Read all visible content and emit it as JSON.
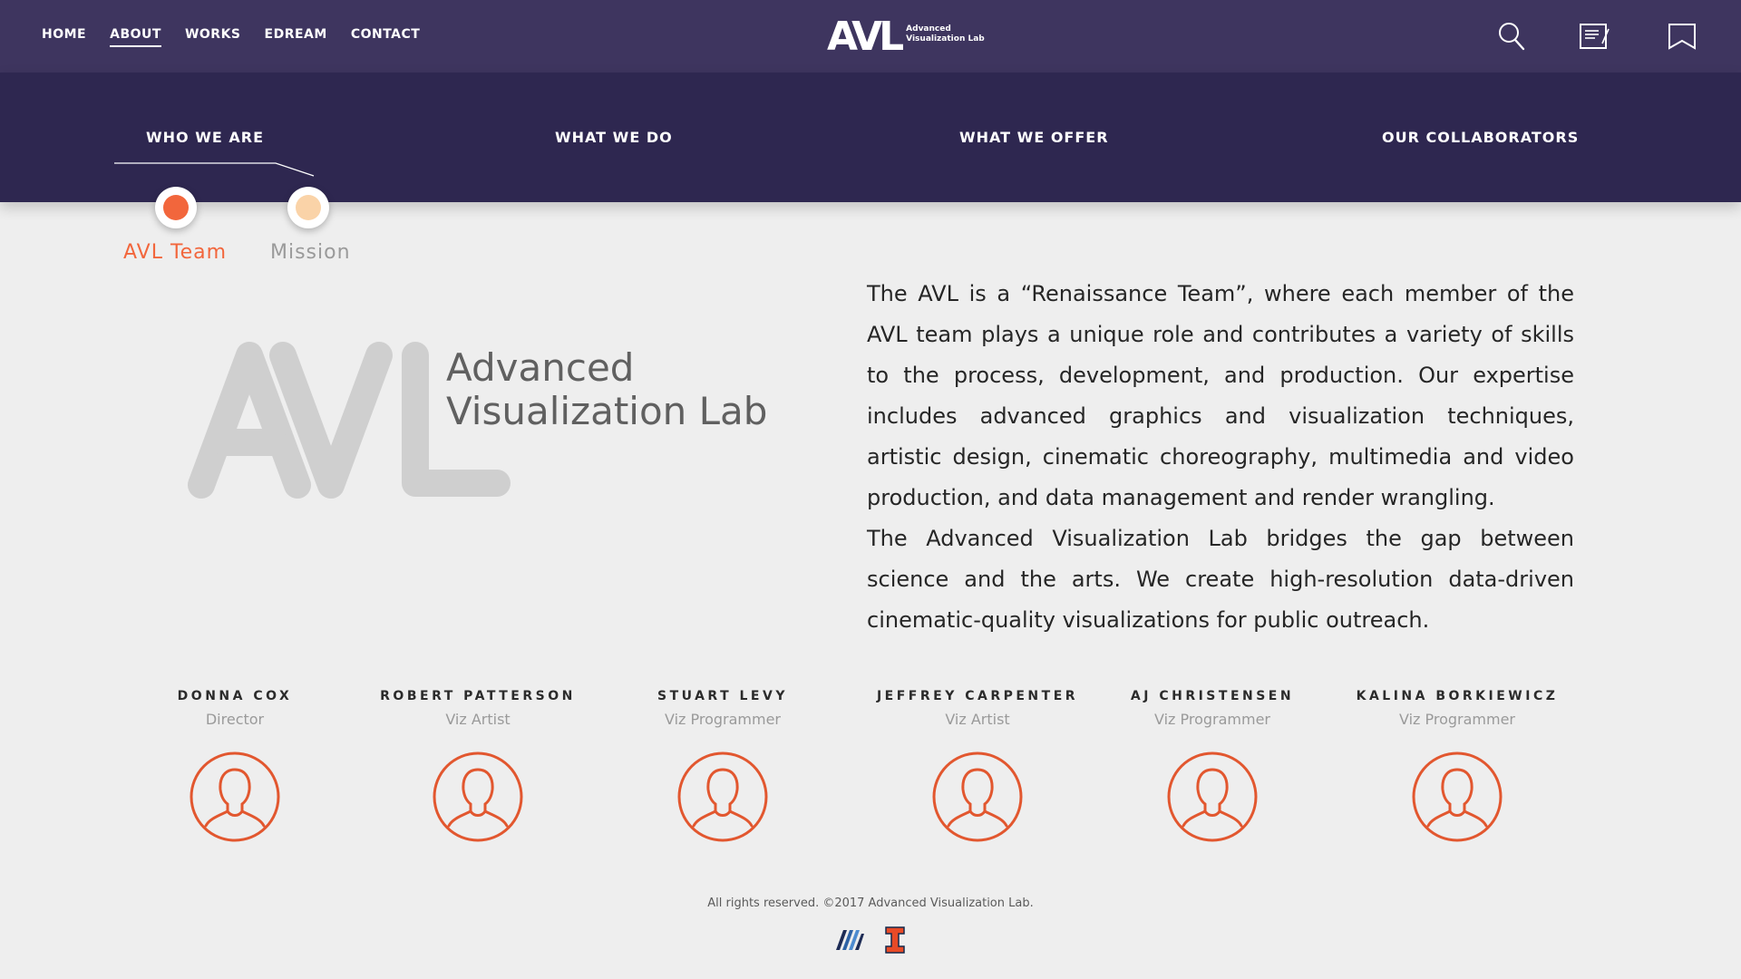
{
  "nav": {
    "items": [
      {
        "label": "HOME",
        "active": false
      },
      {
        "label": "ABOUT",
        "active": true
      },
      {
        "label": "WORKS",
        "active": false
      },
      {
        "label": "EDREAM",
        "active": false
      },
      {
        "label": "CONTACT",
        "active": false
      }
    ]
  },
  "brand": {
    "mark": "AVL",
    "line1": "Advanced",
    "line2": "Visualization Lab"
  },
  "top_icons": [
    "search-icon",
    "notes-icon",
    "bookmark-icon"
  ],
  "sections": [
    {
      "label": "WHO WE ARE",
      "active": true
    },
    {
      "label": "WHAT WE DO",
      "active": false
    },
    {
      "label": "WHAT WE OFFER",
      "active": false
    },
    {
      "label": "OUR COLLABORATORS",
      "active": false
    }
  ],
  "subpages": [
    {
      "label": "AVL Team",
      "active": true,
      "color": "#f2663c"
    },
    {
      "label": "Mission",
      "active": false,
      "color": "#fad3a8"
    }
  ],
  "big_logo": {
    "line1": "Advanced",
    "line2": "Visualization Lab"
  },
  "description": {
    "p1": "The AVL is a “Renaissance Team”, where each member of the AVL team plays a unique role and contributes a variety of skills to the process, development, and production.  Our expertise includes advanced graphics and visualization techniques, artistic design, cinematic choreography, multimedia and video production, and data management and render wrangling.",
    "p2": "The Advanced Visualization Lab bridges the gap between science and the arts. We create high-resolution data-driven cinematic-quality visualizations for public outreach."
  },
  "team": [
    {
      "name": "DONNA COX",
      "role": "Director"
    },
    {
      "name": "ROBERT PATTERSON",
      "role": "Viz Artist"
    },
    {
      "name": "STUART LEVY",
      "role": "Viz Programmer"
    },
    {
      "name": "JEFFREY CARPENTER",
      "role": "Viz Artist"
    },
    {
      "name": "AJ CHRISTENSEN",
      "role": "Viz Programmer"
    },
    {
      "name": "KALINA BORKIEWICZ",
      "role": "Viz Programmer"
    }
  ],
  "footer": {
    "copyright": "All rights reserved. ©2017 Advanced Visualization Lab."
  },
  "colors": {
    "topbar": "#3e355f",
    "subbar": "#2e2750",
    "accent": "#f2663c",
    "accent_light": "#fad3a8",
    "avatar": "#e2572f"
  }
}
